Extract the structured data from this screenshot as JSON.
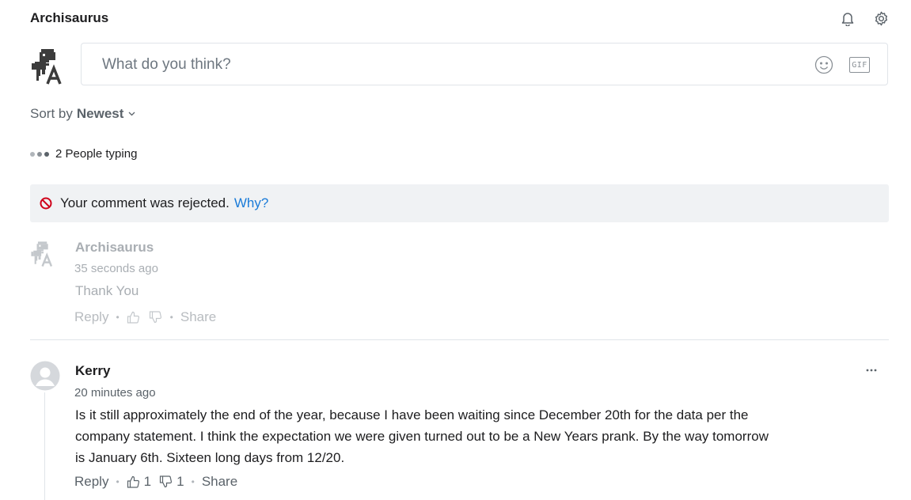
{
  "header": {
    "title": "Archisaurus",
    "bell_icon": "bell-icon",
    "settings_icon": "gear-icon"
  },
  "composer": {
    "placeholder": "What do you think?",
    "emoji_icon": "smiley-icon",
    "gif_label": "GIF"
  },
  "sort": {
    "label": "Sort by",
    "value": "Newest"
  },
  "typing": {
    "text": "2 People typing"
  },
  "rejected": {
    "message": "Your comment was rejected.",
    "link": "Why?",
    "icon": "prohibited-icon",
    "icon_color": "#d0021b",
    "link_color": "#1a7bd8"
  },
  "comments": [
    {
      "author": "Archisaurus",
      "time": "35 seconds ago",
      "body": "Thank You",
      "reply": "Reply",
      "share": "Share",
      "upvotes": "",
      "downvotes": ""
    },
    {
      "author": "Kerry",
      "time": "20 minutes ago",
      "body": "Is it still approximately the end of the year, because I have been waiting since December 20th for the data per the company statement. I think the expectation we were given turned out to be a New Years prank. By the way tomorrow is January 6th. Sixteen long days from 12/20.",
      "reply": "Reply",
      "share": "Share",
      "upvotes": "1",
      "downvotes": "1"
    }
  ]
}
